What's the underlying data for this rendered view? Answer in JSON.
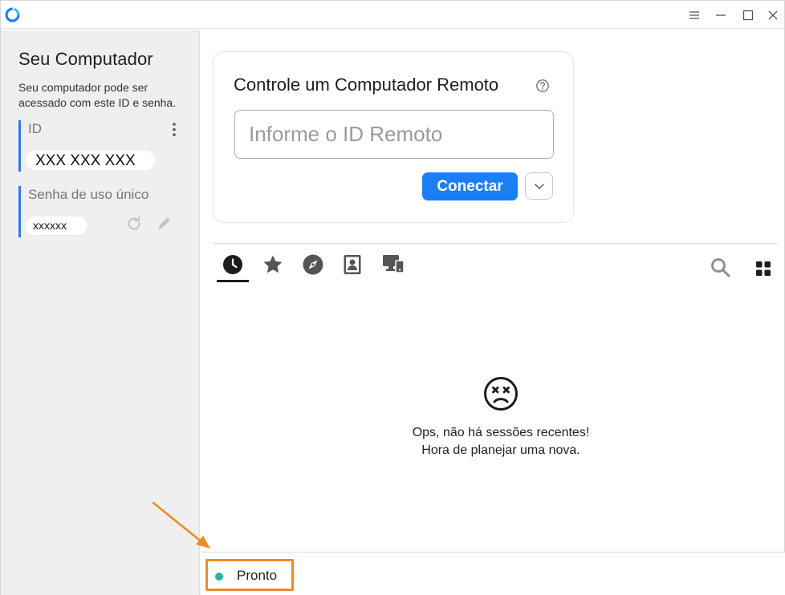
{
  "titlebar": {
    "icons": [
      "app-logo-icon",
      "menu-icon",
      "minimize-icon",
      "maximize-icon",
      "close-icon"
    ]
  },
  "your_computer": {
    "title": "Seu Computador",
    "description": "Seu computador pode ser acessado com este ID e senha.",
    "id_label": "ID",
    "id_value": "XXX XXX XXX",
    "password_label": "Senha de uso único",
    "password_value": "xxxxxx"
  },
  "remote": {
    "title": "Controle um Computador Remoto",
    "input_placeholder": "Informe o ID Remoto",
    "input_value": "",
    "connect_label": "Conectar"
  },
  "tabs": [
    {
      "icon": "clock-icon",
      "active": true
    },
    {
      "icon": "star-icon",
      "active": false
    },
    {
      "icon": "compass-icon",
      "active": false
    },
    {
      "icon": "contact-book-icon",
      "active": false
    },
    {
      "icon": "lan-devices-icon",
      "active": false
    }
  ],
  "toolbar_icons": [
    "search-icon",
    "grid-view-icon"
  ],
  "empty_state": {
    "icon": "sad-face-icon",
    "line1": "Ops, não há sessões recentes!",
    "line2": "Hora de planejar uma nova."
  },
  "status": {
    "text": "Pronto",
    "dot_color": "#26b59c"
  },
  "colors": {
    "accent": "#1a7ff2",
    "highlight_annotation": "#f08a24",
    "sidebar_bg": "#efefef"
  }
}
